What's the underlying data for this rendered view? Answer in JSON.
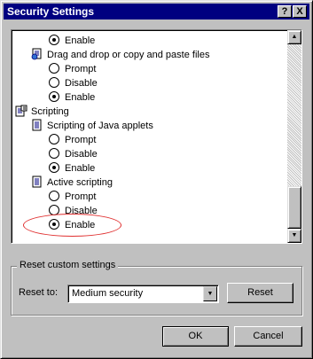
{
  "window": {
    "title": "Security Settings",
    "help_label": "?",
    "close_label": "X"
  },
  "settings_list": {
    "rows": [
      {
        "kind": "radio",
        "label": "Enable",
        "checked": true
      },
      {
        "kind": "item",
        "label": "Drag and drop or copy and paste files",
        "icon": "page-setting-icon"
      },
      {
        "kind": "radio",
        "label": "Prompt",
        "checked": false
      },
      {
        "kind": "radio",
        "label": "Disable",
        "checked": false
      },
      {
        "kind": "radio",
        "label": "Enable",
        "checked": true
      },
      {
        "kind": "category",
        "label": "Scripting",
        "icon": "scripting-category-icon"
      },
      {
        "kind": "item",
        "label": "Scripting of Java applets",
        "icon": "page-setting-icon"
      },
      {
        "kind": "radio",
        "label": "Prompt",
        "checked": false
      },
      {
        "kind": "radio",
        "label": "Disable",
        "checked": false
      },
      {
        "kind": "radio",
        "label": "Enable",
        "checked": true
      },
      {
        "kind": "item",
        "label": "Active scripting",
        "icon": "page-setting-icon"
      },
      {
        "kind": "radio",
        "label": "Prompt",
        "checked": false
      },
      {
        "kind": "radio",
        "label": "Disable",
        "checked": false
      },
      {
        "kind": "radio",
        "label": "Enable",
        "checked": true
      }
    ]
  },
  "reset_group": {
    "legend": "Reset custom settings",
    "reset_to_label": "Reset to:",
    "selected_level": "Medium security",
    "reset_button": "Reset"
  },
  "footer": {
    "ok": "OK",
    "cancel": "Cancel"
  },
  "colors": {
    "titlebar": "#000080",
    "highlight_ellipse": "#e03030"
  }
}
